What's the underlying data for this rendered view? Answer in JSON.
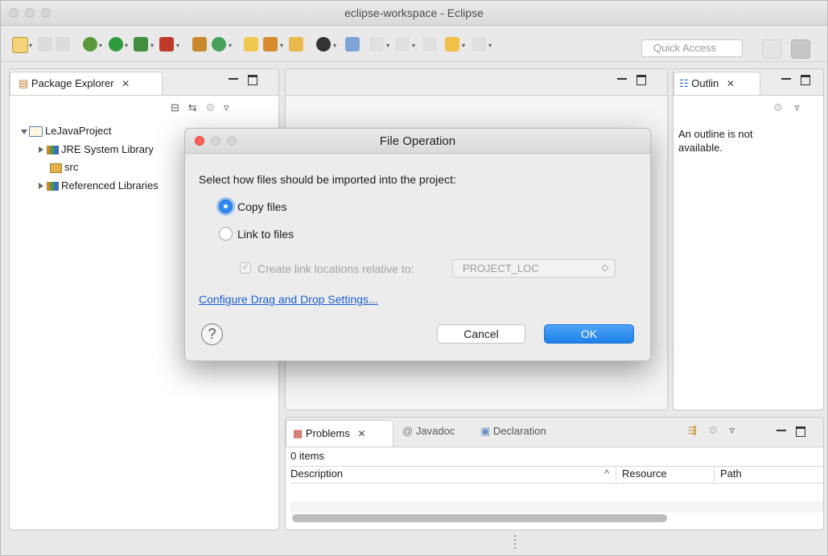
{
  "window": {
    "title": "eclipse-workspace - Eclipse"
  },
  "toolbar": {
    "quick_access_placeholder": "Quick Access"
  },
  "package_explorer": {
    "tab_label": "Package Explorer",
    "tree": [
      {
        "label": "LeJavaProject",
        "icon": "project-folder-icon"
      },
      {
        "label": "JRE System Library",
        "icon": "library-icon"
      },
      {
        "label": "src",
        "icon": "source-folder-icon"
      },
      {
        "label": "Referenced Libraries",
        "icon": "library-icon"
      }
    ]
  },
  "outline": {
    "tab_label": "Outlin",
    "message": "An outline is not available."
  },
  "problems": {
    "tabs": [
      "Problems",
      "Javadoc",
      "Declaration"
    ],
    "count": "0 items",
    "columns": [
      "Description",
      "Resource",
      "Path"
    ]
  },
  "dialog": {
    "title": "File Operation",
    "prompt": "Select how files should be imported into the project:",
    "option_copy": "Copy files",
    "option_link": "Link to files",
    "relative_checkbox": "Create link locations relative to:",
    "relative_value": "PROJECT_LOC",
    "link": "Configure Drag and Drop Settings...",
    "cancel": "Cancel",
    "ok": "OK",
    "help": "?"
  },
  "colors": {
    "accent": "#2f8bf0",
    "link": "#1a5fd6"
  }
}
